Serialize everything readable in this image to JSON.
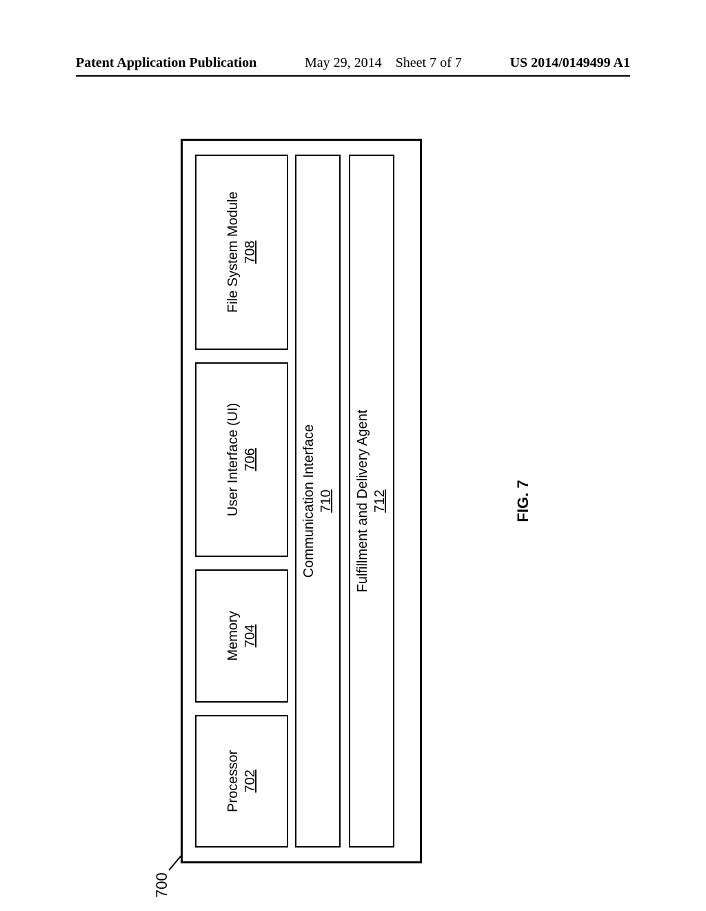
{
  "header": {
    "pub_label": "Patent Application Publication",
    "date": "May 29, 2014",
    "sheet": "Sheet 7 of 7",
    "doc_number": "US 2014/0149499 A1"
  },
  "figure": {
    "ref_number": "700",
    "caption": "FIG. 7",
    "blocks": {
      "processor": {
        "title": "Processor",
        "num": "702"
      },
      "memory": {
        "title": "Memory",
        "num": "704"
      },
      "ui": {
        "title": "User Interface (UI)",
        "num": "706"
      },
      "fsm": {
        "title": "File System Module",
        "num": "708"
      },
      "comm": {
        "title": "Communication Interface",
        "num": "710"
      },
      "fda": {
        "title": "Fulfillment and Delivery Agent",
        "num": "712"
      }
    }
  }
}
